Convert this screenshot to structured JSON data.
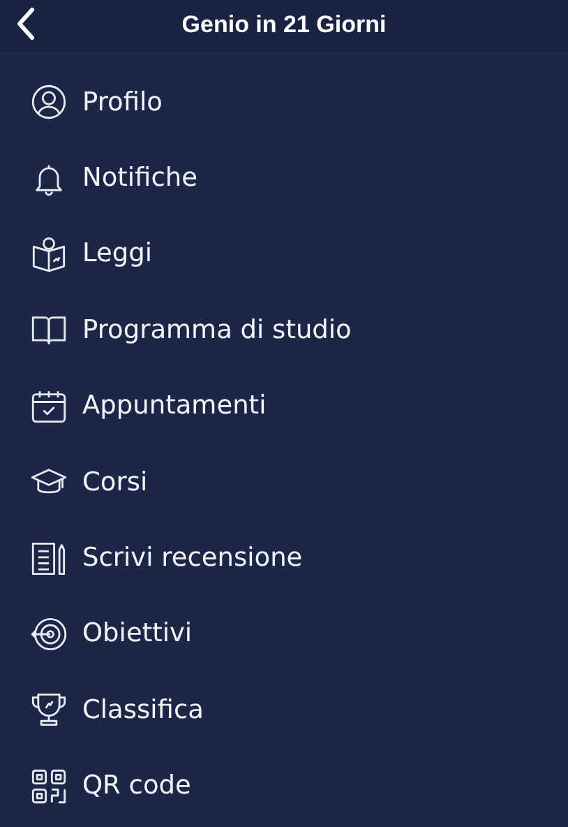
{
  "header": {
    "title": "Genio in 21 Giorni"
  },
  "menu": [
    {
      "kind": "profile",
      "label": "Profilo"
    },
    {
      "kind": "bell",
      "label": "Notifiche"
    },
    {
      "kind": "reading",
      "label": "Leggi"
    },
    {
      "kind": "book",
      "label": "Programma di studio"
    },
    {
      "kind": "calendar",
      "label": "Appuntamenti"
    },
    {
      "kind": "cap",
      "label": "Corsi"
    },
    {
      "kind": "review",
      "label": "Scrivi recensione"
    },
    {
      "kind": "target",
      "label": "Obiettivi"
    },
    {
      "kind": "trophy",
      "label": "Classifica"
    },
    {
      "kind": "qr",
      "label": "QR code"
    }
  ]
}
